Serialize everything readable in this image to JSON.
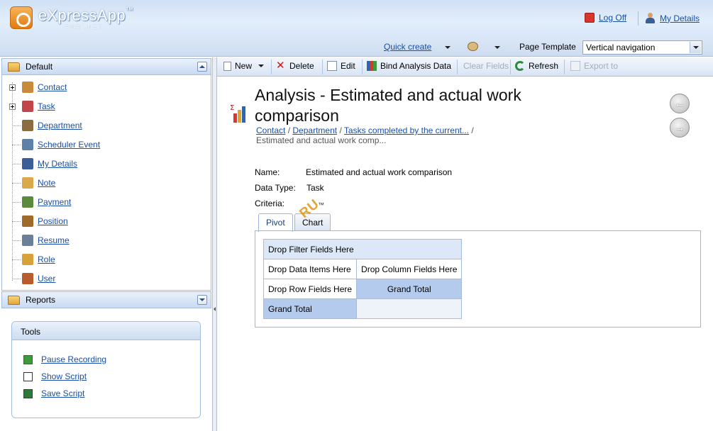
{
  "header": {
    "app_name": "eXpressApp",
    "app_tm": "™",
    "app_sub": "FOR .NET",
    "logoff_label": "Log Off",
    "mydetails_label": "My Details"
  },
  "subbar": {
    "quick_create_label": "Quick create",
    "page_template_label": "Page Template",
    "page_template_value": "Vertical navigation"
  },
  "left": {
    "default_header": "Default",
    "reports_header": "Reports",
    "nav_items": [
      {
        "label": "Contact",
        "expandable": true,
        "color": "#c98a3a"
      },
      {
        "label": "Task",
        "expandable": true,
        "color": "#c2454b"
      },
      {
        "label": "Department",
        "expandable": false,
        "color": "#8c6b3e"
      },
      {
        "label": "Scheduler Event",
        "expandable": false,
        "color": "#5d7fa8"
      },
      {
        "label": "My Details",
        "expandable": false,
        "color": "#3a5e95"
      },
      {
        "label": "Note",
        "expandable": false,
        "color": "#d9a94a"
      },
      {
        "label": "Payment",
        "expandable": false,
        "color": "#5b8a3c"
      },
      {
        "label": "Position",
        "expandable": false,
        "color": "#a06a2a"
      },
      {
        "label": "Resume",
        "expandable": false,
        "color": "#6b7f99"
      },
      {
        "label": "Role",
        "expandable": false,
        "color": "#d8a13a"
      },
      {
        "label": "User",
        "expandable": false,
        "color": "#b85c2e"
      }
    ],
    "tools": {
      "header": "Tools",
      "items": [
        "Pause Recording",
        "Show Script",
        "Save Script"
      ]
    }
  },
  "toolbar": {
    "new_label": "New",
    "delete_label": "Delete",
    "edit_label": "Edit",
    "bind_label": "Bind Analysis Data",
    "clear_label": "Clear Fields",
    "refresh_label": "Refresh",
    "export_label": "Export to"
  },
  "main": {
    "title_line1": "Analysis - Estimated and actual work",
    "title_line2": "comparison",
    "breadcrumbs": [
      "Contact",
      "Department",
      "Tasks completed by the current..."
    ],
    "breadcrumb_sep": "/",
    "breadcrumb_current": "Estimated and actual work comp...",
    "fields": {
      "name_label": "Name:",
      "name_value": "Estimated and actual work comparison",
      "type_label": "Data Type:",
      "type_value": "Task",
      "criteria_label": "Criteria:"
    },
    "watermark": "RU",
    "watermark_tm": "™",
    "tabs": [
      "Pivot",
      "Chart"
    ],
    "pivot": {
      "filter": "Drop Filter Fields Here",
      "data": "Drop Data Items Here",
      "column": "Drop Column Fields Here",
      "row": "Drop Row Fields Here",
      "grand_total_col": "Grand Total",
      "grand_total_row": "Grand Total"
    }
  }
}
